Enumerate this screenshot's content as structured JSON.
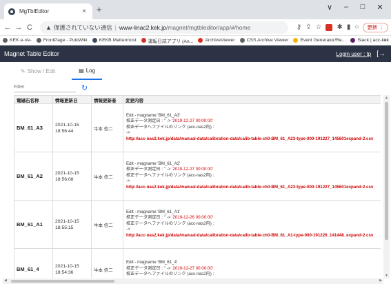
{
  "browser": {
    "tab_title": "MgTblEditor",
    "tab_close": "×",
    "new_tab": "+",
    "window_controls": {
      "collapse": "∨",
      "minimize": "–",
      "maximize": "□",
      "close": "✕"
    },
    "security_text": "保護されていない通信",
    "url_host": "www-linac2.kek.jp",
    "url_path": "/magnet/mgtbleditor/app/#/home",
    "update_label": "更新 ⋮",
    "bookmarks": [
      {
        "label": "KEK e-r/e-",
        "color": "#5f6368"
      },
      {
        "label": "FrontPage - PukiWiki",
        "color": "#5f6368"
      },
      {
        "label": "KEKB Mattermost",
        "color": "#3c4a5e"
      },
      {
        "label": "運転日誌アプリ (An...",
        "color": "#d93025"
      },
      {
        "label": "ArchiveViewer",
        "color": "#d93025"
      },
      {
        "label": "CSS Archive Viewer",
        "color": "#5f6368"
      },
      {
        "label": "Event Generator/Re...",
        "color": "#f4b400"
      },
      {
        "label": "Slack | acc-kek",
        "color": "#611f69"
      }
    ],
    "bookmarks_more": "»"
  },
  "app": {
    "title": "Magnet Table Editor",
    "login_user": "Login user : tp",
    "tabs": [
      {
        "label": "Show / Edit",
        "icon": "edit-icon"
      },
      {
        "label": "Log",
        "icon": "log-icon"
      }
    ],
    "filter_placeholder": "Filter"
  },
  "table": {
    "headers": [
      "電磁石名称",
      "情報更新日",
      "情報更新者",
      "変更内容"
    ],
    "rows": [
      {
        "name": "BM_61_A3",
        "date": "2021-10-15",
        "time": "18:56:44",
        "user": "牛本 信二",
        "edit_line": "Edit - magname 'BM_61_A3'",
        "date_line_prefix": "校正データ測定日 : '' -> ",
        "date_line_value": "'2019-12-27 00:00:00'",
        "file_line": "校正データへファイルのリンク (acc-nas2内) :",
        "arrow": "->",
        "link": "http://acc-nas2.kek.jp/data/manual-data/calibration-data/calib-table-ch0-BM_61_A23-type-000-191227_145601expand-2.csv"
      },
      {
        "name": "BM_61_A2",
        "date": "2021-10-15",
        "time": "18:56:08",
        "user": "牛本 信二",
        "edit_line": "Edit - magname 'BM_61_A2'",
        "date_line_prefix": "校正データ測定日 : '' -> ",
        "date_line_value": "'2019-12-27 00:00:00'",
        "file_line": "校正データへファイルのリンク (acc-nas2内) :",
        "arrow": "->",
        "link": "http://acc-nas2.kek.jp/data/manual-data/calibration-data/calib-table-ch0-BM_61_A23-type-000-191227_145601expand-2.csv"
      },
      {
        "name": "BM_61_A1",
        "date": "2021-10-15",
        "time": "18:55:15",
        "user": "牛本 信二",
        "edit_line": "Edit - magname 'BM_61_A1'",
        "date_line_prefix": "校正データ測定日 : '' -> ",
        "date_line_value": "'2019-12-26 00:00:00'",
        "file_line": "校正データへファイルのリンク (acc-nas2内) :",
        "arrow": "->",
        "link": "http://acc-nas2.kek.jp/data/manual-data/calibration-data/calib-table-ch0-BM_61_A1-type-000-191226_141448_expand-2.csv"
      },
      {
        "name": "BM_61_4",
        "date": "2021-10-15",
        "time": "18:54:36",
        "user": "牛本 信二",
        "edit_line": "Edit - magname 'BM_61_4'",
        "date_line_prefix": "校正データ測定日 : '' -> ",
        "date_line_value": "'2019-12-27 00:00:00'",
        "file_line": "校正データへファイルのリンク (acc-nas2内) :",
        "arrow": "",
        "link": ""
      }
    ]
  },
  "colors": {
    "header_bg": "#2c3344",
    "tab_accent": "#1a73e8",
    "link_red": "#d00000"
  }
}
